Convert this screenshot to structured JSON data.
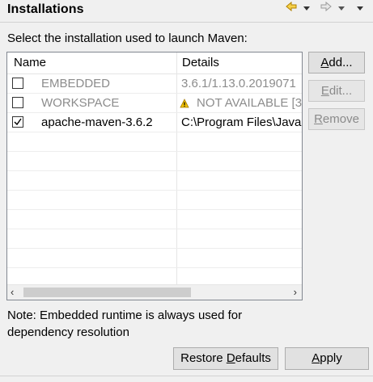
{
  "header": {
    "title": "Installations"
  },
  "nav": {
    "back_icon": "back-arrow-icon",
    "forward_icon": "forward-arrow-icon",
    "menu_icon": "view-menu-icon"
  },
  "instruction": "Select the installation used to launch Maven:",
  "table": {
    "columns": [
      "Name",
      "Details"
    ],
    "rows": [
      {
        "checked": false,
        "name": "EMBEDDED",
        "details": "3.6.1/1.13.0.2019071",
        "disabled": true,
        "warning": false
      },
      {
        "checked": false,
        "name": "WORKSPACE",
        "details": "NOT AVAILABLE [3",
        "disabled": true,
        "warning": true
      },
      {
        "checked": true,
        "name": "apache-maven-3.6.2",
        "details": "C:\\Program Files\\Java",
        "disabled": false,
        "warning": false
      }
    ]
  },
  "buttons": {
    "add": {
      "label": "Add...",
      "accel": "A",
      "rest": "dd..."
    },
    "edit": {
      "label": "Edit...",
      "accel": "E",
      "rest": "dit..."
    },
    "remove": {
      "label": "Remove",
      "accel": "R",
      "rest": "emove"
    },
    "restore": {
      "pre": "Restore ",
      "accel": "D",
      "rest": "efaults"
    },
    "apply": {
      "pre": "",
      "accel": "A",
      "rest": "pply"
    }
  },
  "note": "Note: Embedded runtime is always used for dependency resolution",
  "colors": {
    "link": "#1a1a1a",
    "warning": "#e6b800"
  }
}
